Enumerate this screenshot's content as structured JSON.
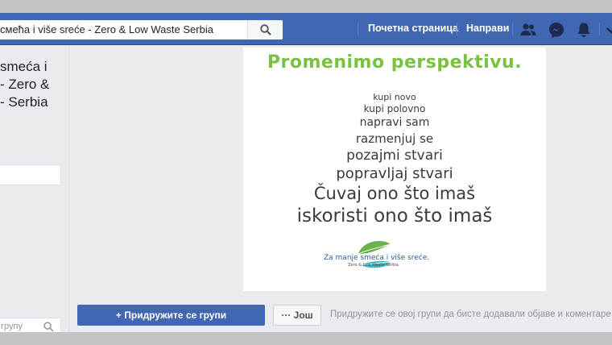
{
  "topbar": {
    "search_value": "смећа i više sreće - Zero & Low Waste Serbia",
    "nav_home": "Почетна страница",
    "nav_create": "Направи",
    "icons": [
      "friends-icon",
      "messenger-icon",
      "notifications-icon"
    ]
  },
  "sidebar": {
    "group_name": "smeća i\n- Zero &\n- Serbia",
    "search_placeholder": "групу"
  },
  "cover": {
    "title": "Promenimo  perspektivu.",
    "lines": [
      "kupi novo",
      "kupi polovno",
      "napravi sam",
      "razmenjuj se",
      "pozajmi stvari",
      "popravljaj stvari",
      "Čuvaj ono što imaš",
      "iskoristi ono što imaš"
    ],
    "logo_text": "Za manje smeća i više sreće.",
    "logo_subtext": "Zero & Low Waste Serbia"
  },
  "actions": {
    "join_label": "+ Придружите се групи",
    "more_label": "··· Још",
    "join_hint": "Придружите се овој групи да бисте додавали објаве и коментаре."
  },
  "colors": {
    "facebook_blue": "#4267b2",
    "cover_green": "#7ac143"
  }
}
